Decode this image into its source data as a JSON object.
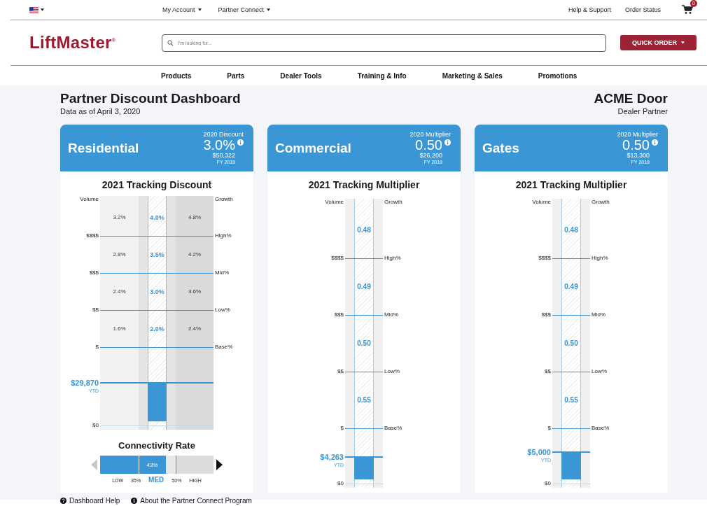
{
  "top_bar": {
    "menus": [
      "My Account",
      "Partner Connect"
    ],
    "links": [
      "Help & Support",
      "Order Status"
    ],
    "cart_count": "0"
  },
  "header": {
    "logo": "LiftMaster$^{®}$",
    "search": {
      "placeholder": "I'm looking for..."
    },
    "quick_order": "QUICK ORDER"
  },
  "nav": [
    "Products",
    "Parts",
    "Dealer Tools",
    "Training & Info",
    "Marketing & Sales",
    "Promotions"
  ],
  "dashboard": {
    "title": "Partner Discount Dashboard",
    "as_of": "Data as of April 3, 2020",
    "dealer": "ACME Door",
    "dealer_role": "Dealer Partner"
  },
  "cards": [
    {
      "kind": "discount",
      "name": "Residential",
      "rate_label": "2020 Discount",
      "rate": "3.0%",
      "amount": "$50,322",
      "period": "FY 2019",
      "tracking_title": "2021 Tracking Discount",
      "volume_label": "Volume",
      "growth_label": "Growth",
      "tiers": [
        {
          "values": [
            "3.2%",
            "4.0%",
            "4.8%"
          ],
          "volume": "$$$$",
          "growth": "High%"
        },
        {
          "values": [
            "2.8%",
            "3.5%",
            "4.2%"
          ],
          "volume": "$$$",
          "growth": "Mid%"
        },
        {
          "values": [
            "2.4%",
            "3.0%",
            "3.6%"
          ],
          "volume": "$$",
          "growth": "Low%"
        },
        {
          "values": [
            "1.6%",
            "2.0%",
            "2.4%"
          ],
          "volume": "$",
          "growth": "Base%"
        }
      ],
      "ytd_amount": "$29,870",
      "ytd_label": "YTD",
      "zero_label": "$0",
      "level": 0.54,
      "connectivity": {
        "title": "Connectivity Rate",
        "level": 0.58,
        "value": "43%",
        "prev_disabled": true,
        "next_disabled": false,
        "scale": [
          {
            "label": "LOW",
            "selected": false
          },
          {
            "label": "35%",
            "selected": false
          },
          {
            "label": "MED",
            "selected": true
          },
          {
            "label": "50%",
            "selected": false
          },
          {
            "label": "HIGH",
            "selected": false
          }
        ]
      }
    },
    {
      "kind": "multiplier",
      "name": "Commercial",
      "rate_label": "2020 Multiplier",
      "rate": "0.50",
      "amount": "$26,200",
      "period": "FY 2019",
      "tracking_title": "2021 Tracking Multiplier",
      "volume_label": "Volume",
      "growth_label": "Growth",
      "tiers": [
        {
          "values": [
            "0.48"
          ],
          "volume": "$$$$",
          "growth": "High%"
        },
        {
          "values": [
            "0.49"
          ],
          "volume": "$$$",
          "growth": "Mid%"
        },
        {
          "values": [
            "0.50"
          ],
          "volume": "$$",
          "growth": "Low%"
        },
        {
          "values": [
            "0.55"
          ],
          "volume": "$",
          "growth": "Base%"
        }
      ],
      "ytd_amount": "$4,263",
      "ytd_label": "YTD",
      "zero_label": "$0",
      "level": 0.46
    },
    {
      "kind": "multiplier",
      "name": "Gates",
      "rate_label": "2020 Multiplier",
      "rate": "0.50",
      "amount": "$13,300",
      "period": "FY 2019",
      "tracking_title": "2021 Tracking Multiplier",
      "volume_label": "Volume",
      "growth_label": "Growth",
      "tiers": [
        {
          "values": [
            "0.48"
          ],
          "volume": "$$$$",
          "growth": "High%"
        },
        {
          "values": [
            "0.49"
          ],
          "volume": "$$$",
          "growth": "Mid%"
        },
        {
          "values": [
            "0.50"
          ],
          "volume": "$$",
          "growth": "Low%"
        },
        {
          "values": [
            "0.55"
          ],
          "volume": "$",
          "growth": "Base%"
        }
      ],
      "ytd_amount": "$5,000",
      "ytd_label": "YTD",
      "zero_label": "$0",
      "level": 0.57
    }
  ],
  "footer_links": [
    {
      "kind": "help",
      "label": "Dashboard Help"
    },
    {
      "kind": "info",
      "label": "About the Partner Connect Program"
    }
  ]
}
